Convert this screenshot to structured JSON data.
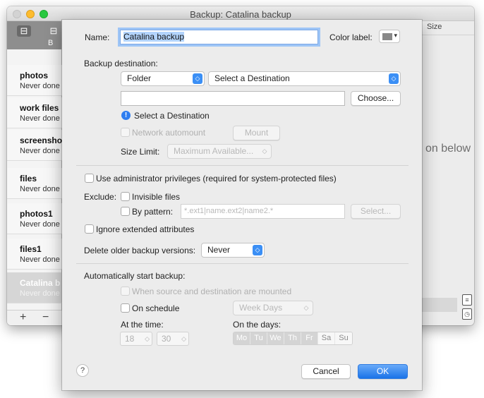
{
  "window": {
    "title": "Backup: Catalina backup",
    "sidebar_tab_label": "B",
    "items": [
      {
        "name": "photos",
        "status": "Never done"
      },
      {
        "name": "work files",
        "status": "Never done"
      },
      {
        "name": "screenshots",
        "status": "Never done"
      },
      {
        "name": "files",
        "status": "Never done"
      },
      {
        "name": "photos1",
        "status": "Never done"
      },
      {
        "name": "files1",
        "status": "Never done"
      },
      {
        "name": "Catalina b",
        "status": "Never done"
      }
    ],
    "add_label": "+",
    "remove_label": "−",
    "size_header": "Size",
    "background_hint": "on below"
  },
  "sheet": {
    "name_label": "Name:",
    "name_value": "Catalina backup",
    "color_label": "Color label:",
    "color_label_value": "#888888",
    "backup_destination_label": "Backup destination:",
    "dest_type": "Folder",
    "dest_select": "Select a Destination",
    "choose_button": "Choose...",
    "warning_text": "Select a Destination",
    "network_automount": "Network automount",
    "mount_button": "Mount",
    "size_limit_label": "Size Limit:",
    "size_limit_value": "Maximum Available...",
    "admin_privileges": "Use administrator privileges (required for system-protected files)",
    "exclude_label": "Exclude:",
    "invisible_files": "Invisible files",
    "by_pattern": "By pattern:",
    "pattern_placeholder": "*.ext1|name.ext2|name2.*",
    "select_button": "Select...",
    "ignore_attributes": "Ignore extended attributes",
    "delete_older_label": "Delete older backup versions:",
    "delete_older_value": "Never",
    "auto_start_label": "Automatically start backup:",
    "when_mounted": "When source and destination are mounted",
    "on_schedule": "On schedule",
    "schedule_value": "Week Days",
    "at_time_label": "At the time:",
    "hour": "18",
    "minute": "30",
    "on_days_label": "On the days:",
    "days": [
      {
        "label": "Mo",
        "selected": true
      },
      {
        "label": "Tu",
        "selected": true
      },
      {
        "label": "We",
        "selected": true
      },
      {
        "label": "Th",
        "selected": true
      },
      {
        "label": "Fr",
        "selected": true
      },
      {
        "label": "Sa",
        "selected": false
      },
      {
        "label": "Su",
        "selected": false
      }
    ],
    "help_label": "?",
    "cancel_button": "Cancel",
    "ok_button": "OK"
  },
  "colors": {
    "accent": "#1a73e8",
    "focus_ring": "#9ec5f6"
  }
}
